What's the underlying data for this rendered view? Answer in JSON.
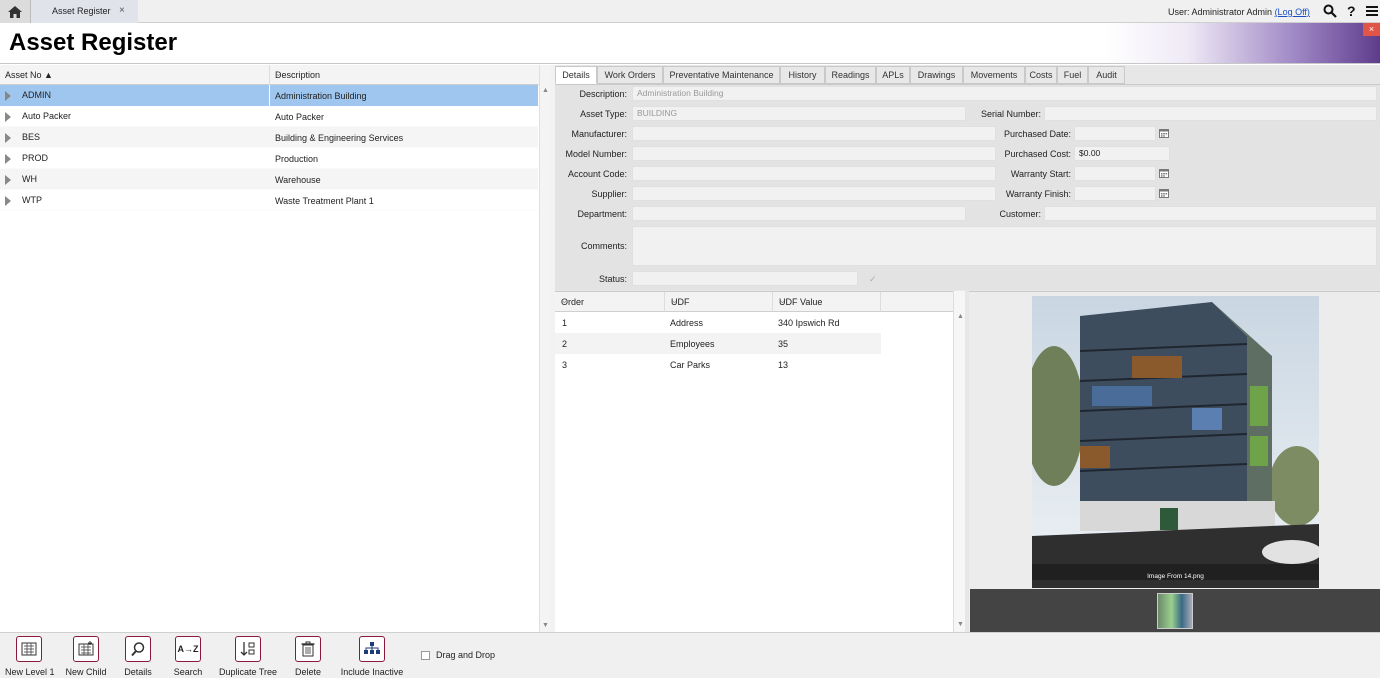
{
  "topbar": {
    "breadcrumb_tab": "Asset Register",
    "close_tab": "×",
    "user_label": "User: Administrator Admin",
    "logoff_label": "(Log Off)",
    "help_glyph": "?"
  },
  "page_title": "Asset Register",
  "close_glyph": "×",
  "left_grid": {
    "col_asset_no": "Asset No ▲",
    "col_description": "Description",
    "rows": [
      {
        "asset_no": "ADMIN",
        "description": "Administration Building",
        "selected": true
      },
      {
        "asset_no": "Auto Packer",
        "description": "Auto Packer",
        "selected": false
      },
      {
        "asset_no": "BES",
        "description": "Building & Engineering Services",
        "selected": false
      },
      {
        "asset_no": "PROD",
        "description": "Production",
        "selected": false
      },
      {
        "asset_no": "WH",
        "description": "Warehouse",
        "selected": false
      },
      {
        "asset_no": "WTP",
        "description": "Waste Treatment Plant 1",
        "selected": false
      }
    ]
  },
  "tabs": [
    "Details",
    "Work Orders",
    "Preventative Maintenance",
    "History",
    "Readings",
    "APLs",
    "Drawings",
    "Movements",
    "Costs",
    "Fuel",
    "Audit"
  ],
  "active_tab": "Details",
  "form": {
    "description_label": "Description:",
    "description_value": "Administration Building",
    "asset_type_label": "Asset Type:",
    "asset_type_value": "BUILDING",
    "serial_label": "Serial Number:",
    "manufacturer_label": "Manufacturer:",
    "purchased_date_label": "Purchased Date:",
    "model_label": "Model Number:",
    "purchased_cost_label": "Purchased Cost:",
    "purchased_cost_value": "$0.00",
    "account_label": "Account Code:",
    "warranty_start_label": "Warranty Start:",
    "supplier_label": "Supplier:",
    "warranty_finish_label": "Warranty Finish:",
    "department_label": "Department:",
    "customer_label": "Customer:",
    "comments_label": "Comments:",
    "status_label": "Status:",
    "status_check": "✓"
  },
  "udf_grid": {
    "col_order": "Order",
    "col_udf": "UDF",
    "col_value": "UDF Value",
    "rows": [
      {
        "order": "1",
        "udf": "Address",
        "value": "340 Ipswich Rd"
      },
      {
        "order": "2",
        "udf": "Employees",
        "value": "35"
      },
      {
        "order": "3",
        "udf": "Car Parks",
        "value": "13"
      }
    ]
  },
  "image_caption": "Image From 14.png",
  "toolbar": [
    {
      "label": "New Level 1",
      "icon": "new-level-icon"
    },
    {
      "label": "New Child",
      "icon": "new-child-icon"
    },
    {
      "label": "Details",
      "icon": "details-icon"
    },
    {
      "label": "Search",
      "icon": "search-az-icon"
    },
    {
      "label": "Duplicate Tree",
      "icon": "duplicate-tree-icon"
    },
    {
      "label": "Delete",
      "icon": "delete-icon"
    },
    {
      "label": "Include Inactive",
      "icon": "include-inactive-icon"
    }
  ],
  "drag_drop_label": "Drag and Drop",
  "colors": {
    "selection": "#9ec6ee",
    "accent": "#8a1a3a",
    "link": "#1a4fc4"
  }
}
